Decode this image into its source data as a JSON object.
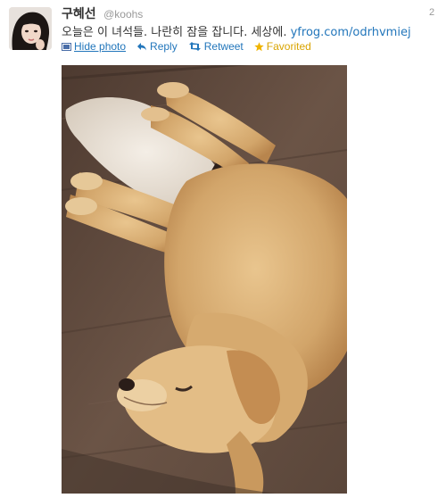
{
  "tweet": {
    "display_name": "구혜선",
    "screen_name": "@koohs",
    "timestamp": "2",
    "text": "오늘은 이 녀석들. 나란히 잠을 잡니다. 세상에. ",
    "link_text": "yfrog.com/odrhvmiej"
  },
  "actions": {
    "hide_photo": "Hide photo",
    "reply": "Reply",
    "retweet": "Retweet",
    "favorited": "Favorited"
  },
  "icons": {
    "hide_photo": "photo-icon",
    "reply": "reply-arrow-icon",
    "retweet": "retweet-icon",
    "favorited": "star-icon"
  },
  "colors": {
    "link": "#2276bb",
    "favorited": "#d9a400",
    "muted": "#999999",
    "text": "#333333"
  }
}
